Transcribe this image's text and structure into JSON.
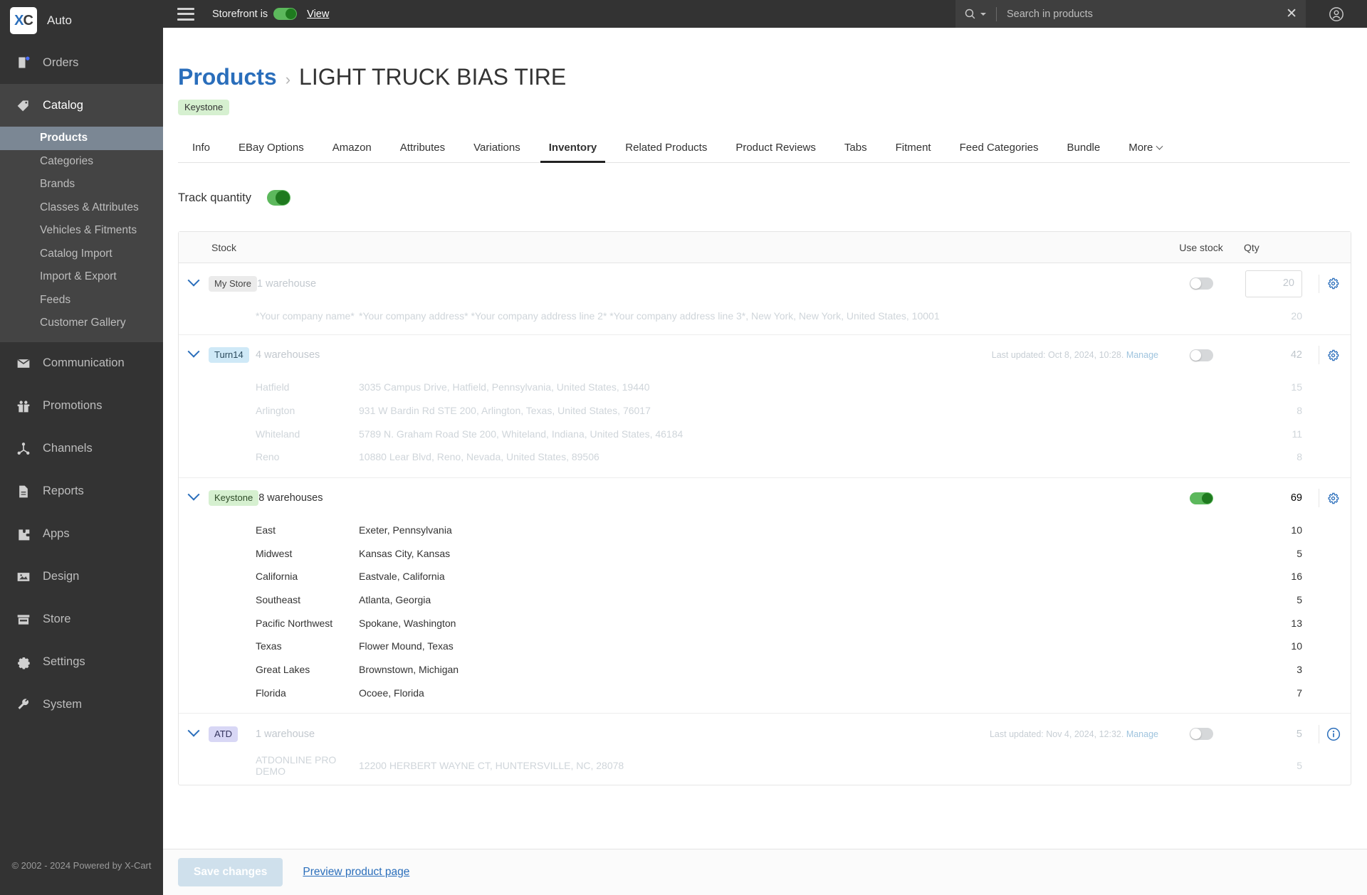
{
  "sidebar": {
    "brand": {
      "logo_x": "X",
      "logo_c": "C",
      "name": "Auto"
    },
    "items": [
      {
        "label": "Orders",
        "icon": "orders-icon"
      },
      {
        "label": "Catalog",
        "icon": "tag-icon"
      },
      {
        "label": "Communication",
        "icon": "envelope-icon"
      },
      {
        "label": "Promotions",
        "icon": "gift-icon"
      },
      {
        "label": "Channels",
        "icon": "channels-icon"
      },
      {
        "label": "Reports",
        "icon": "report-icon"
      },
      {
        "label": "Apps",
        "icon": "puzzle-icon"
      },
      {
        "label": "Design",
        "icon": "image-icon"
      },
      {
        "label": "Store",
        "icon": "storefront-icon"
      },
      {
        "label": "Settings",
        "icon": "gear-icon"
      },
      {
        "label": "System",
        "icon": "wrench-icon"
      }
    ],
    "catalog_sub": [
      {
        "label": "Products",
        "active": true
      },
      {
        "label": "Categories",
        "active": false
      },
      {
        "label": "Brands",
        "active": false
      },
      {
        "label": "Classes & Attributes",
        "active": false
      },
      {
        "label": "Vehicles & Fitments",
        "active": false
      },
      {
        "label": "Catalog Import",
        "active": false
      },
      {
        "label": "Import & Export",
        "active": false
      },
      {
        "label": "Feeds",
        "active": false
      },
      {
        "label": "Customer Gallery",
        "active": false
      }
    ],
    "copyright": "© 2002 - 2024 Powered by X-Cart"
  },
  "topbar": {
    "storefront_label": "Storefront is",
    "storefront_on": true,
    "view_label": "View",
    "search_placeholder": "Search in products",
    "search_value": ""
  },
  "page": {
    "breadcrumb_link": "Products",
    "breadcrumb_sep": "›",
    "title": "LIGHT TRUCK BIAS TIRE",
    "tag": "Keystone",
    "tabs": [
      {
        "label": "Info",
        "active": false
      },
      {
        "label": "EBay Options",
        "active": false
      },
      {
        "label": "Amazon",
        "active": false
      },
      {
        "label": "Attributes",
        "active": false
      },
      {
        "label": "Variations",
        "active": false
      },
      {
        "label": "Inventory",
        "active": true
      },
      {
        "label": "Related Products",
        "active": false
      },
      {
        "label": "Product Reviews",
        "active": false
      },
      {
        "label": "Tabs",
        "active": false
      },
      {
        "label": "Fitment",
        "active": false
      },
      {
        "label": "Feed Categories",
        "active": false
      },
      {
        "label": "Bundle",
        "active": false
      },
      {
        "label": "More",
        "active": false,
        "has_chevron": true
      }
    ],
    "track_quantity_label": "Track quantity",
    "track_quantity_on": true
  },
  "table": {
    "headers": {
      "stock": "Stock",
      "use_stock": "Use stock",
      "qty": "Qty"
    },
    "groups": [
      {
        "badge": "My Store",
        "badge_style": "mystore",
        "warehouse_count": "1 warehouse",
        "meta": "",
        "meta_link": "",
        "use_stock_on": false,
        "qty": "20",
        "qty_is_input": true,
        "action": "gear-icon",
        "dim": true,
        "warehouses": [
          {
            "name": "*Your company name*",
            "address": "*Your company address* *Your company address line 2* *Your company address line 3*, New York, New York, United States, 10001",
            "qty": "20"
          }
        ]
      },
      {
        "badge": "Turn14",
        "badge_style": "turn14",
        "warehouse_count": "4 warehouses",
        "meta": "Last updated: Oct 8, 2024, 10:28.",
        "meta_link": "Manage",
        "use_stock_on": false,
        "qty": "42",
        "qty_is_input": false,
        "action": "gear-icon",
        "dim": true,
        "warehouses": [
          {
            "name": "Hatfield",
            "address": "3035 Campus Drive, Hatfield, Pennsylvania, United States, 19440",
            "qty": "15"
          },
          {
            "name": "Arlington",
            "address": "931 W Bardin Rd STE 200, Arlington, Texas, United States, 76017",
            "qty": "8"
          },
          {
            "name": "Whiteland",
            "address": "5789 N. Graham Road Ste 200, Whiteland, Indiana, United States, 46184",
            "qty": "11"
          },
          {
            "name": "Reno",
            "address": "10880 Lear Blvd, Reno, Nevada, United States, 89506",
            "qty": "8"
          }
        ]
      },
      {
        "badge": "Keystone",
        "badge_style": "keystone",
        "warehouse_count": "8 warehouses",
        "meta": "",
        "meta_link": "",
        "use_stock_on": true,
        "qty": "69",
        "qty_is_input": false,
        "action": "gear-icon",
        "dim": false,
        "warehouses": [
          {
            "name": "East",
            "address": "Exeter, Pennsylvania",
            "qty": "10"
          },
          {
            "name": "Midwest",
            "address": "Kansas City, Kansas",
            "qty": "5"
          },
          {
            "name": "California",
            "address": "Eastvale, California",
            "qty": "16"
          },
          {
            "name": "Southeast",
            "address": "Atlanta, Georgia",
            "qty": "5"
          },
          {
            "name": "Pacific Northwest",
            "address": "Spokane, Washington",
            "qty": "13"
          },
          {
            "name": "Texas",
            "address": "Flower Mound, Texas",
            "qty": "10"
          },
          {
            "name": "Great Lakes",
            "address": "Brownstown, Michigan",
            "qty": "3"
          },
          {
            "name": "Florida",
            "address": "Ocoee, Florida",
            "qty": "7"
          }
        ]
      },
      {
        "badge": "ATD",
        "badge_style": "atd",
        "warehouse_count": "1 warehouse",
        "meta": "Last updated: Nov 4, 2024, 12:32.",
        "meta_link": "Manage",
        "use_stock_on": false,
        "qty": "5",
        "qty_is_input": false,
        "action": "info-icon",
        "dim": true,
        "warehouses": [
          {
            "name": "ATDONLINE PRO DEMO",
            "address": "12200 HERBERT WAYNE CT, HUNTERSVILLE, NC, 28078",
            "qty": "5"
          }
        ]
      }
    ]
  },
  "actionbar": {
    "save_label": "Save changes",
    "preview_label": "Preview product page"
  }
}
